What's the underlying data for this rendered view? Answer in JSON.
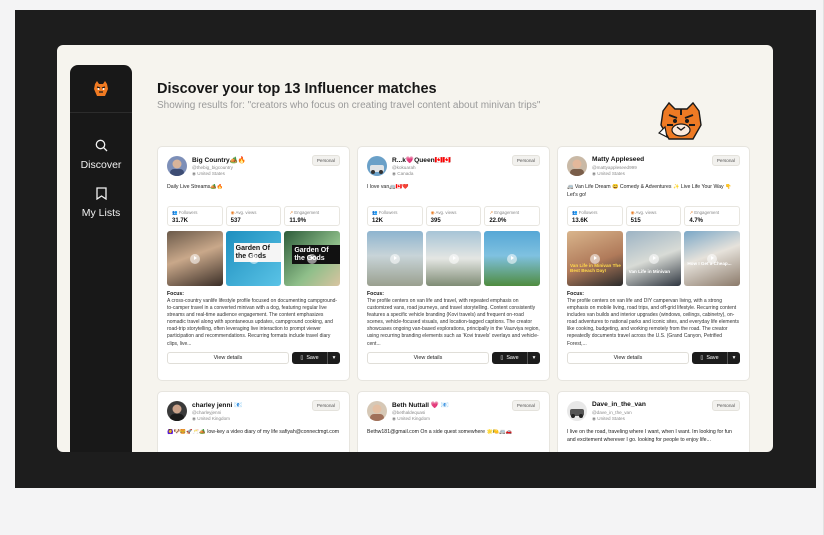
{
  "header": {
    "title": "Discover your top 13 Influencer matches",
    "subtitle": "Showing results for: \"creators who focus on creating travel content about minivan trips\""
  },
  "sidebar": {
    "items": [
      {
        "label": "Discover",
        "icon": "search-icon"
      },
      {
        "label": "My Lists",
        "icon": "bookmark-icon"
      }
    ]
  },
  "stat_labels": {
    "followers": "Followers",
    "views": "Avg. views",
    "engagement": "Engagement"
  },
  "actions": {
    "view_label": "View details",
    "save_label": "Save"
  },
  "focus_label": "Focus:",
  "cards": [
    {
      "name": "Big Country🏕️🔥",
      "handle": "@thebig_bigcountry",
      "country": "United States",
      "badge": "Personal",
      "bio": "Daily Live Streams🏕️🔥",
      "followers": "31.7K",
      "views": "537",
      "engagement": "11.9%",
      "thumb_texts": [
        "",
        "Garden Of the Gods",
        "Garden Of the Gods"
      ],
      "focus": "A cross-country vanlife lifestyle profile focused on documenting campground-to-camper travel in a converted minivan with a dog, featuring regular live streams and real-time audience engagement. The content emphasizes nomadic travel along with spontaneous updates, campground cooking, and road-trip storytelling, often leveraging live interaction to prompt viewer participation and recommendations. Recurring formats include travel diary clips, live..."
    },
    {
      "name": "R...k💗Queen🇨🇦🇨🇦",
      "handle": "@kokuarah",
      "country": "Canada",
      "badge": "Personal",
      "bio": "I love van🚐🇨🇦❤️",
      "followers": "12K",
      "views": "395",
      "engagement": "22.0%",
      "thumb_texts": [
        "",
        "",
        ""
      ],
      "focus": "The profile centers on van life and travel, with repeated emphasis on customized vans, road journeys, and travel storytelling. Content consistently features a specific vehicle branding (Kovi travels) and frequent on-road scenes, vehicle-focused visuals, and location-tagged captions. The creator showcases ongoing van-based explorations, principally in the Vaurviya region, using recurring branding elements such as 'Kovi travels' overlays and vehicle-cent..."
    },
    {
      "name": "Matty Appleseed",
      "handle": "@mattyappleseed999",
      "country": "United States",
      "badge": "Personal",
      "bio": "🚐 Van Life Dream 😄 Comedy & Adventures ✨ Live Life Your Way 👇 Let's go!",
      "followers": "13.6K",
      "views": "515",
      "engagement": "4.7%",
      "thumb_texts": [
        "Van Life in Minivan The Best Beach Day!",
        "Van Life in Minivan",
        "How I Get a Cheap..."
      ],
      "focus": "The profile centers on van life and DIY campervan living, with a strong emphasis on mobile living, road trips, and off-grid lifestyle. Recurring content includes van builds and interior upgrades (windows, ceilings, cabinetry), on-road adventures to national parks and iconic sites, and everyday life elements like cooking, budgeting, and working remotely from the road. The creator repeatedly documents travel across the U.S. (Grand Canyon, Petrified Forest,..."
    },
    {
      "name": "charley jenni 📧",
      "handle": "@charleyjenni",
      "country": "United Kingdom",
      "badge": "Personal",
      "bio": "🙆‍♀️🐶🍔🚀🥂🏕️ low-key a video diary of my life safiyah@connectmgt.com"
    },
    {
      "name": "Beth Nuttall 💗 📧",
      "handle": "@bethaldequasi",
      "country": "United Kingdom",
      "badge": "Personal",
      "bio": "Bethw181@gmail.com On a side quest somewhere 🌟🍋🚐🚗"
    },
    {
      "name": "Dave_in_the_van",
      "handle": "@dave_in_the_van",
      "country": "United States",
      "badge": "Personal",
      "bio": "I live on the road, traveling where I want, when I want. Im looking for fun and excitement wherever I go. looking for people to enjoy life..."
    }
  ],
  "colors": {
    "sidebar_bg": "#181818",
    "stage_bg": "#1d1d1d",
    "app_bg": "#f6f4ee",
    "accent_orange": "#e8802b"
  }
}
